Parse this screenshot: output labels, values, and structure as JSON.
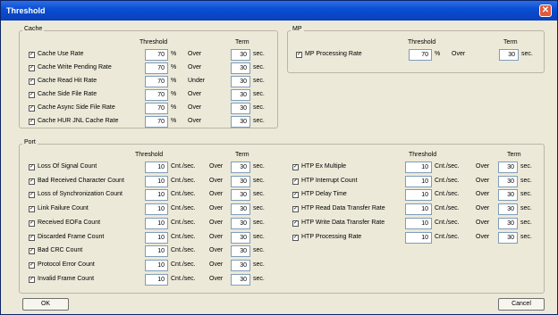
{
  "window": {
    "title": "Threshold"
  },
  "cache": {
    "legend": "Cache",
    "threshold_header": "Threshold",
    "term_header": "Term",
    "rows": [
      {
        "label": "Cache Use Rate",
        "checked": true,
        "threshold": "70",
        "unit": "%",
        "cmp": "Over",
        "term": "30",
        "term_unit": "sec."
      },
      {
        "label": "Cache Write Pending Rate",
        "checked": true,
        "threshold": "70",
        "unit": "%",
        "cmp": "Over",
        "term": "30",
        "term_unit": "sec."
      },
      {
        "label": "Cache Read Hit Rate",
        "checked": true,
        "threshold": "70",
        "unit": "%",
        "cmp": "Under",
        "term": "30",
        "term_unit": "sec."
      },
      {
        "label": "Cache Side File Rate",
        "checked": true,
        "threshold": "70",
        "unit": "%",
        "cmp": "Over",
        "term": "30",
        "term_unit": "sec."
      },
      {
        "label": "Cache Async Side File Rate",
        "checked": true,
        "threshold": "70",
        "unit": "%",
        "cmp": "Over",
        "term": "30",
        "term_unit": "sec."
      },
      {
        "label": "Cache HUR JNL Cache Rate",
        "checked": true,
        "threshold": "70",
        "unit": "%",
        "cmp": "Over",
        "term": "30",
        "term_unit": "sec."
      }
    ]
  },
  "mp": {
    "legend": "MP",
    "threshold_header": "Threshold",
    "term_header": "Term",
    "rows": [
      {
        "label": "MP Processing Rate",
        "checked": true,
        "threshold": "70",
        "unit": "%",
        "cmp": "Over",
        "term": "30",
        "term_unit": "sec."
      }
    ]
  },
  "port": {
    "legend": "Port",
    "threshold_header": "Threshold",
    "term_header": "Term",
    "left_rows": [
      {
        "label": "Loss Of Signal Count",
        "checked": true,
        "threshold": "10",
        "unit": "Cnt./sec.",
        "cmp": "Over",
        "term": "30",
        "term_unit": "sec."
      },
      {
        "label": "Bad Received Character Count",
        "checked": true,
        "threshold": "10",
        "unit": "Cnt./sec.",
        "cmp": "Over",
        "term": "30",
        "term_unit": "sec."
      },
      {
        "label": "Loss of Synchronization Count",
        "checked": true,
        "threshold": "10",
        "unit": "Cnt./sec.",
        "cmp": "Over",
        "term": "30",
        "term_unit": "sec."
      },
      {
        "label": "Link Failure Count",
        "checked": true,
        "threshold": "10",
        "unit": "Cnt./sec.",
        "cmp": "Over",
        "term": "30",
        "term_unit": "sec."
      },
      {
        "label": "Received EOFa Count",
        "checked": true,
        "threshold": "10",
        "unit": "Cnt./sec.",
        "cmp": "Over",
        "term": "30",
        "term_unit": "sec."
      },
      {
        "label": "Discarded Frame Count",
        "checked": true,
        "threshold": "10",
        "unit": "Cnt./sec.",
        "cmp": "Over",
        "term": "30",
        "term_unit": "sec."
      },
      {
        "label": "Bad CRC Count",
        "checked": true,
        "threshold": "10",
        "unit": "Cnt./sec.",
        "cmp": "Over",
        "term": "30",
        "term_unit": "sec."
      },
      {
        "label": "Protocol Error Count",
        "checked": true,
        "threshold": "10",
        "unit": "Cnt./sec.",
        "cmp": "Over",
        "term": "30",
        "term_unit": "sec."
      },
      {
        "label": "Invalid Frame Count",
        "checked": true,
        "threshold": "10",
        "unit": "Cnt./sec.",
        "cmp": "Over",
        "term": "30",
        "term_unit": "sec."
      }
    ],
    "right_rows": [
      {
        "label": "HTP Ex Multiple",
        "checked": true,
        "threshold": "10",
        "unit": "Cnt./sec.",
        "cmp": "Over",
        "term": "30",
        "term_unit": "sec."
      },
      {
        "label": "HTP Interrupt Count",
        "checked": true,
        "threshold": "10",
        "unit": "Cnt./sec.",
        "cmp": "Over",
        "term": "30",
        "term_unit": "sec."
      },
      {
        "label": "HTP Delay Time",
        "checked": true,
        "threshold": "10",
        "unit": "Cnt./sec.",
        "cmp": "Over",
        "term": "30",
        "term_unit": "sec."
      },
      {
        "label": "HTP Read Data Transfer Rate",
        "checked": true,
        "threshold": "10",
        "unit": "Cnt./sec.",
        "cmp": "Over",
        "term": "30",
        "term_unit": "sec."
      },
      {
        "label": "HTP Write Data Transfer Rate",
        "checked": true,
        "threshold": "10",
        "unit": "Cnt./sec.",
        "cmp": "Over",
        "term": "30",
        "term_unit": "sec."
      },
      {
        "label": "HTP Processing Rate",
        "checked": true,
        "threshold": "10",
        "unit": "Cnt./sec.",
        "cmp": "Over",
        "term": "30",
        "term_unit": "sec."
      }
    ]
  },
  "buttons": {
    "ok": "OK",
    "cancel": "Cancel"
  },
  "icons": {
    "close": "close-icon",
    "checkbox": "checkmark-icon"
  }
}
